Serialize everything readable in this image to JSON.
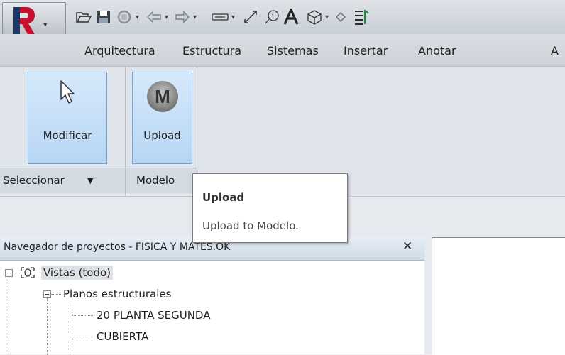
{
  "quick_access": {
    "app_menu_icon": "revit-R-icon",
    "icons": [
      "open-folder-icon",
      "save-icon",
      "sync-icon",
      "undo-icon",
      "redo-icon",
      "measure-icon",
      "aligned-dimension-icon",
      "tag-icon",
      "text-icon",
      "3d-view-icon",
      "section-icon",
      "thin-lines-icon"
    ]
  },
  "ribbon_tabs": [
    "Arquitectura",
    "Estructura",
    "Sistemas",
    "Insertar",
    "Anotar",
    "A"
  ],
  "ribbon": {
    "modify_label": "Modificar",
    "upload_label": "Upload",
    "group_select_label": "Seleccionar",
    "group_select_dropdown": "▼",
    "group_modelo_label": "Modelo"
  },
  "tooltip": {
    "title": "Upload",
    "description": "Upload to Modelo."
  },
  "browser": {
    "title": "Navegador de proyectos - FISICA Y MATES.OK",
    "close": "✕",
    "tree": [
      {
        "label": "Vistas (todo)",
        "level": 0
      },
      {
        "label": "Planos estructurales",
        "level": 1
      },
      {
        "label": "20 PLANTA SEGUNDA",
        "level": 2
      },
      {
        "label": "CUBIERTA",
        "level": 2
      }
    ]
  },
  "colors": {
    "ribbon_bg": "#dfe4ea",
    "button_highlight": "#b7d6f4",
    "button_border": "#6aa7dd",
    "revit_red": "#c8102e"
  }
}
